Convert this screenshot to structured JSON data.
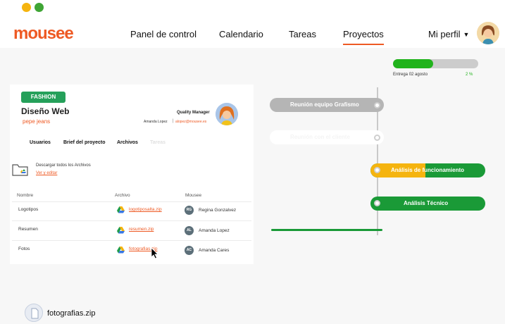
{
  "app": {
    "logo": "mousee"
  },
  "nav": {
    "items": [
      {
        "label": "Panel de control"
      },
      {
        "label": "Calendario"
      },
      {
        "label": "Tareas"
      },
      {
        "label": "Proyectos",
        "active": true
      }
    ],
    "profile_label": "Mi perfil"
  },
  "progress": {
    "percent": 47,
    "label_prefix": "Entrega",
    "label_date": "02 agosto",
    "percent_text": "2 %"
  },
  "project": {
    "tag": "FASHION",
    "title": "Diseño Web",
    "client": "pepe jeans",
    "manager": {
      "role": "Quality Manager",
      "name": "Amanda Lopez",
      "email": "alopez@mousee.es"
    },
    "tabs": [
      "Usuarios",
      "Brief del proyecto",
      "Archivos",
      "Tareas"
    ],
    "download_all": "Descargar todos los Archivos",
    "view_edit": "Ver y editar",
    "table": {
      "headers": [
        "Nombre",
        "Archivo",
        "Mousee"
      ],
      "rows": [
        {
          "name": "Logotipos",
          "file": "logotiposalta.zip",
          "initials": "RG",
          "person": "Regina Gonzalvez"
        },
        {
          "name": "Resumen",
          "file": "resumen.zip",
          "initials": "AL",
          "person": "Amanda Lopez"
        },
        {
          "name": "Fotos",
          "file": "fotografias.zip",
          "initials": "AC",
          "person": "Amanda Cares"
        }
      ]
    }
  },
  "timeline": {
    "nodes": [
      {
        "label": "Reunión equipo Grafismo",
        "status": "done",
        "color": "#b5b5b5"
      },
      {
        "label": "Reunión con el cliente",
        "status": "faded",
        "color": "#ffffff"
      },
      {
        "label": "Análisis de funcionamiento",
        "status": "in-progress",
        "color": "#1a9a37",
        "accent": "#f5b40f"
      },
      {
        "label": "Análisis Técnico",
        "status": "pending",
        "color": "#1a9a37"
      }
    ]
  },
  "download": {
    "filename": "fotografias.zip"
  },
  "colors": {
    "brand": "#ee5a24",
    "green": "#1a9a37",
    "progress": "#21b31c",
    "grey": "#b5b5b5"
  }
}
